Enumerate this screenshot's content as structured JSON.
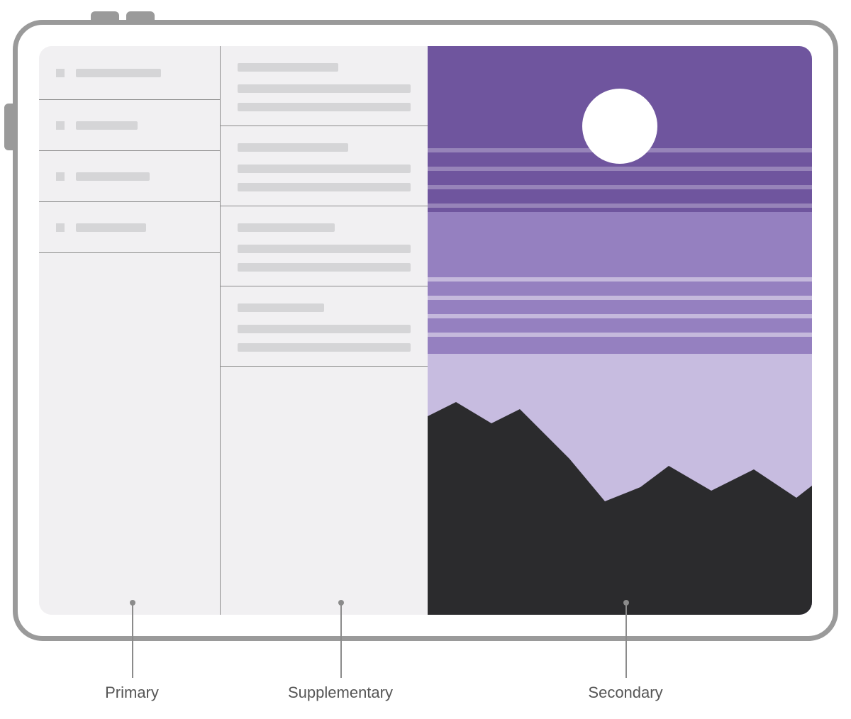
{
  "diagram": {
    "labels": {
      "primary": "Primary",
      "supplementary": "Supplementary",
      "secondary": "Secondary"
    }
  },
  "columns": {
    "primary": {
      "items": [
        {
          "bullet": true,
          "width_pct": 58
        },
        {
          "bullet": true,
          "width_pct": 42
        },
        {
          "bullet": true,
          "width_pct": 50
        },
        {
          "bullet": true,
          "width_pct": 48
        }
      ]
    },
    "supplementary": {
      "blocks": [
        {
          "title_width_pct": 58,
          "lines": [
            100,
            100
          ]
        },
        {
          "title_width_pct": 64,
          "lines": [
            100,
            100
          ]
        },
        {
          "title_width_pct": 56,
          "lines": [
            100,
            100
          ]
        },
        {
          "title_width_pct": 50,
          "lines": [
            100,
            100
          ]
        }
      ]
    }
  },
  "colors": {
    "frame": "#9a9a9a",
    "screen_bg": "#f1f0f2",
    "placeholder": "#d5d5d7",
    "divider": "#8b8b8b",
    "sky_dark": "#6f559e",
    "sky_mid": "#9580c0",
    "sky_light": "#c7bce0",
    "mountain": "#2b2b2d",
    "label": "#555555"
  }
}
